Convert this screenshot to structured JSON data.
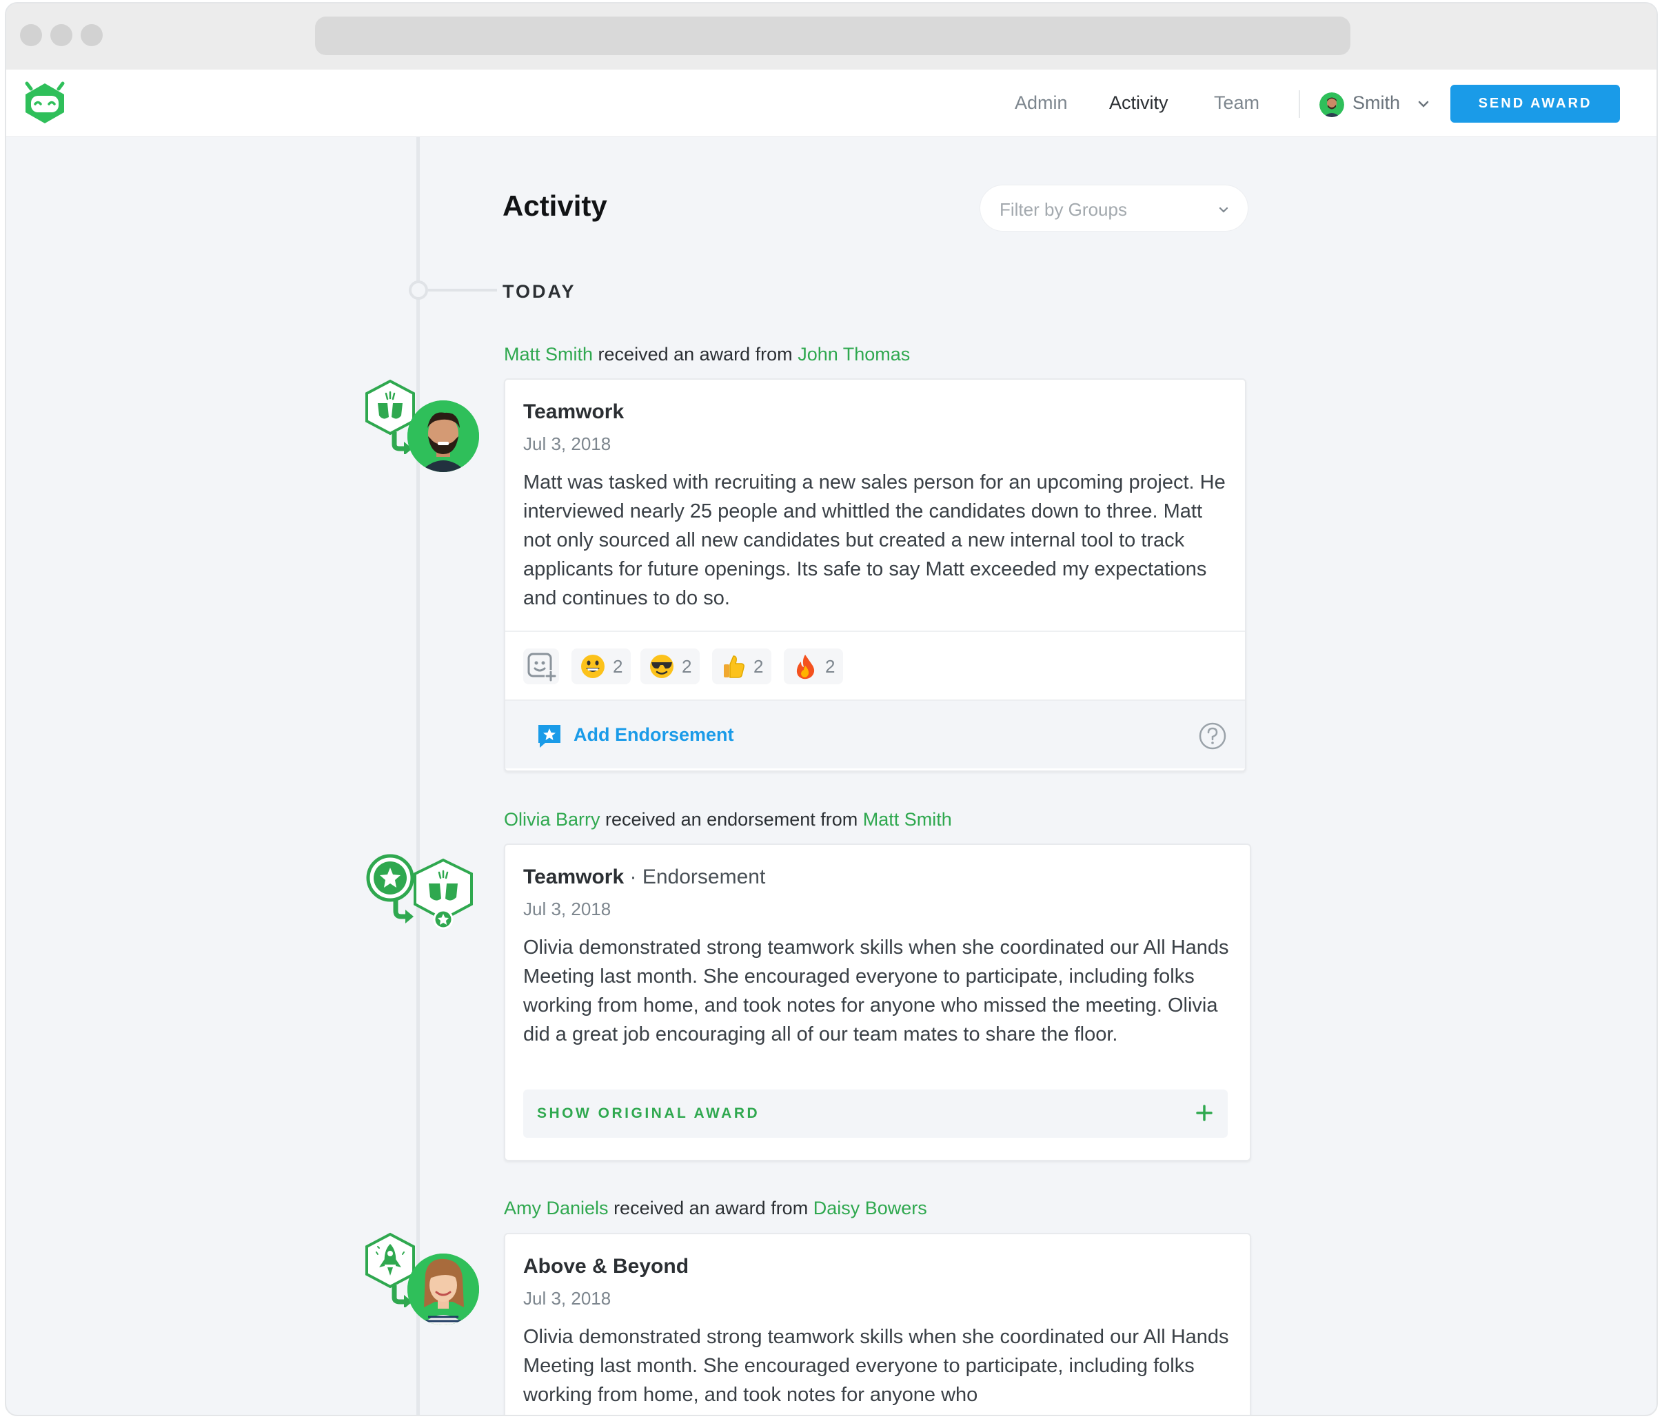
{
  "nav": {
    "links": [
      "Admin",
      "Activity",
      "Team"
    ],
    "active": "Activity",
    "user_name": "Smith",
    "send_award_label": "SEND AWARD"
  },
  "page": {
    "title": "Activity",
    "filter_placeholder": "Filter by Groups",
    "section_label": "TODAY"
  },
  "feed": [
    {
      "recipient": "Matt Smith",
      "verb": "received an award from",
      "giver": "John Thomas",
      "title": "Teamwork",
      "date": "Jul 3, 2018",
      "body": "Matt was tasked with recruiting a new sales person for an upcoming project. He interviewed nearly 25 people and whittled the candidates down to three. Matt not only sourced all new candidates but created a new internal tool to track applicants for future openings. Its safe to say Matt exceeded my expectations and continues to do so.",
      "reactions": [
        {
          "emoji": "grinning-face",
          "count": "2"
        },
        {
          "emoji": "sunglasses-face",
          "count": "2"
        },
        {
          "emoji": "thumbs-up",
          "count": "2"
        },
        {
          "emoji": "fire",
          "count": "2"
        }
      ],
      "endorse_label": "Add Endorsement"
    },
    {
      "recipient": "Olivia Barry",
      "verb": "received an endorsement from",
      "giver": "Matt Smith",
      "title": "Teamwork",
      "subtitle": "· Endorsement",
      "date": "Jul 3, 2018",
      "body": "Olivia demonstrated strong teamwork skills when she coordinated our All Hands Meeting last month. She encouraged everyone to participate, including folks working from home, and took notes for anyone who missed the meeting. Olivia did a great job encouraging all of our team mates to share the floor.",
      "show_original_label": "SHOW ORIGINAL AWARD"
    },
    {
      "recipient": "Amy Daniels",
      "verb": "received an award from",
      "giver": "Daisy Bowers",
      "title": "Above & Beyond",
      "date": "Jul 3, 2018",
      "body": "Olivia demonstrated strong teamwork skills when she coordinated our All Hands Meeting last month. She encouraged everyone to participate, including folks working from home, and took notes for anyone who"
    }
  ],
  "colors": {
    "brand_green": "#2fa84f",
    "accent_blue": "#1a9be8",
    "background": "#f3f5f8"
  }
}
